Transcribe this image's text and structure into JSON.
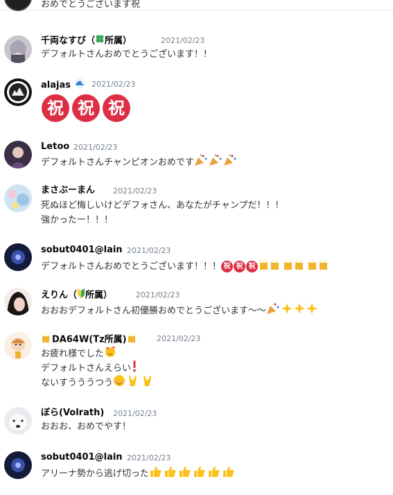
{
  "messages": [
    {
      "lines": [
        "おめでとうございます祝"
      ]
    },
    {
      "name": "千両なすび（",
      "name_suffix": "所属）",
      "timestamp": "2021/02/23",
      "lines": [
        "デフォルトさんおめでとうございます！！"
      ]
    },
    {
      "name": "alajas",
      "timestamp": "2021/02/23",
      "big_emoji": "祝"
    },
    {
      "name": "Letoo",
      "timestamp": "2021/02/23",
      "lines": [
        "デフォルトさんチャンピオンおめです"
      ]
    },
    {
      "name": "まさぶーまん",
      "timestamp": "2021/02/23",
      "lines": [
        "死ぬほど悔しいけどデフォさん、あなたがチャンプだ！！！",
        "強かったー！！！"
      ]
    },
    {
      "name": "sobut0401@lain",
      "timestamp": "2021/02/23",
      "lines": [
        "デフォルトさんおめでとうございます！！！"
      ],
      "iwai": "祝"
    },
    {
      "name": "えりん（",
      "name_suffix": "所属）",
      "timestamp": "2021/02/23",
      "lines": [
        "おおおデフォルトさん初優勝おめでとうございます〜〜"
      ]
    },
    {
      "name": "DA64W(Tz所属)",
      "timestamp": "2021/02/23",
      "lines": [
        "お疲れ様でした",
        "デフォルトさんえらい",
        "ないすうううつう"
      ]
    },
    {
      "name": "ぼら(Volrath)",
      "timestamp": "2021/02/23",
      "lines": [
        "おおお、おめでやす！"
      ]
    },
    {
      "name": "sobut0401@lain",
      "timestamp": "2021/02/23",
      "lines": [
        "アリーナ勢から逃げ切った"
      ]
    }
  ],
  "colors": {
    "name": "#060607",
    "timestamp": "#747f8d",
    "iwai": "#dd2e44",
    "divider": "#e3e5e8"
  },
  "icons": [
    "clover-icon",
    "wave-icon",
    "party-popper-icon",
    "beer-mug-icon",
    "beginner-mark-icon",
    "sparkles-icon",
    "smiling-face-hearts-icon",
    "exclamation-icon",
    "blush-icon",
    "rock-on-icon",
    "thumbs-up-icon"
  ]
}
